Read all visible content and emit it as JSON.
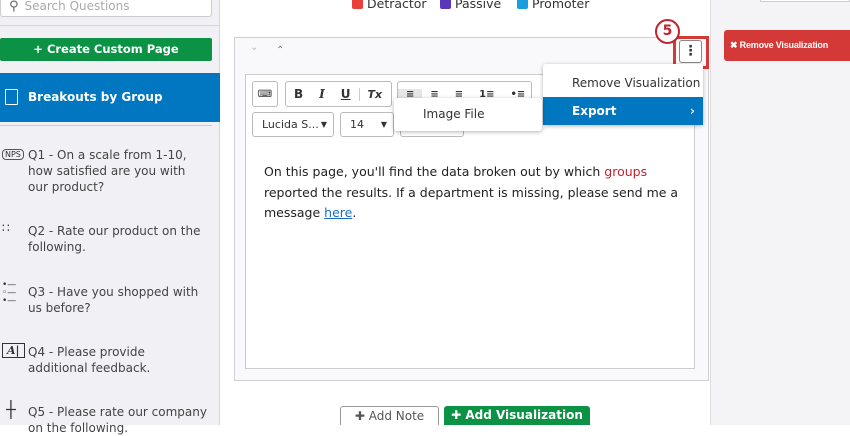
{
  "sidebar": {
    "search_placeholder": "Search Questions",
    "create_button": "Create Custom Page",
    "active_page": "Breakouts by Group",
    "questions": [
      {
        "icon": "NPS",
        "label": "Q1 - On a scale from 1-10, how satisfied are you with our product?"
      },
      {
        "icon": "matrix-icon",
        "label": "Q2 - Rate our product on the following."
      },
      {
        "icon": "multiple-choice-icon",
        "label": "Q3 - Have you shopped with us before?"
      },
      {
        "icon": "text-entry-icon",
        "label": "Q4 - Please provide additional feedback."
      },
      {
        "icon": "slider-icon",
        "label": "Q5 - Please rate our company on the following."
      }
    ]
  },
  "legend": [
    {
      "label": "Detractor",
      "color": "#e8403a"
    },
    {
      "label": "Passive",
      "color": "#5b36b8"
    },
    {
      "label": "Promoter",
      "color": "#1a9ee0"
    }
  ],
  "toolbar": {
    "bold": "B",
    "italic": "I",
    "underline": "U",
    "clear": "Tx",
    "font": "Lucida S...",
    "size": "14"
  },
  "content": {
    "part1": "On this page, you'll find the data broken out by which ",
    "highlight": "groups",
    "part2": " reported the results. If a department is missing, please send me a message ",
    "link": "here",
    "part3": "."
  },
  "menu": {
    "remove": "Remove Visualization",
    "export": "Export",
    "submenu_item": "Image File"
  },
  "step_badge": "5",
  "right": {
    "remove_button": "Remove Visualization"
  },
  "bottom": {
    "add_note": "Add Note",
    "add_visualization": "Add Visualization"
  }
}
